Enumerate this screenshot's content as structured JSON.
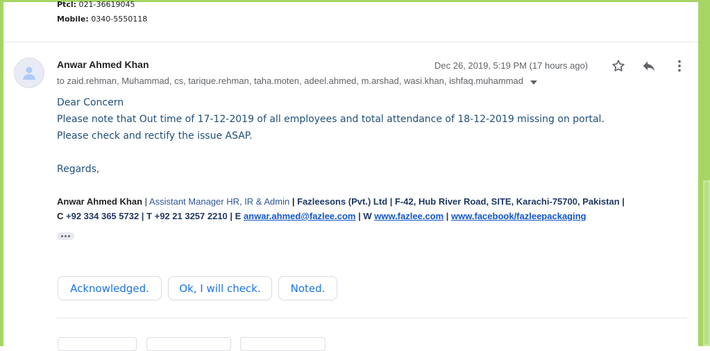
{
  "previous_message": {
    "ptcl_label": "Ptcl:",
    "ptcl_value": "021-36619045",
    "mobile_label": "Mobile:",
    "mobile_value": "0340-5550118"
  },
  "message": {
    "sender_name": "Anwar Ahmed Khan",
    "date": "Dec 26, 2019, 5:19 PM (17 hours ago)",
    "recipients": "to zaid.rehman, Muhammad, cs, tarique.rehman, taha.moten, adeel.ahmed, m.arshad, wasi.khan, ishfaq.muhammad",
    "body": [
      "Dear Concern",
      "Please note that Out time of 17-12-2019 of all employees and total attendance of 18-12-2019 missing on portal.",
      "Please check and rectify the issue ASAP.",
      "Regards,"
    ],
    "signature": {
      "name": "Anwar Ahmed Khan",
      "sep1": " | ",
      "title": "Assistant Manager HR, IR & Admin",
      "sep2": "  | ",
      "company": "Fazleesons (Pvt.) Ltd | F-42, Hub River Road, SITE, Karachi-75700, Pakistan |",
      "line2_prefix_c": "C ",
      "phone_mobile": "+92 334 365 5732",
      "line2_mid": "  | T +92 21 3257 2210 | E ",
      "email": "anwar.ahmed@fazlee.com",
      "sep_w": " | W ",
      "website": "www.fazlee.com",
      "sep_fb": " | ",
      "facebook": "www.facebook/fazleepackaging"
    }
  },
  "smart_replies": [
    "Acknowledged.",
    "Ok, I will check.",
    "Noted."
  ],
  "colors": {
    "frame": "#a6d564",
    "link": "#1155cc",
    "body_text": "#1f4e79",
    "chip_text": "#1a73e8"
  },
  "icons": {
    "avatar": "default-person-icon",
    "star": "star-icon",
    "reply": "reply-icon",
    "more": "more-vert-icon",
    "recipient_toggle": "caret-down-icon"
  }
}
